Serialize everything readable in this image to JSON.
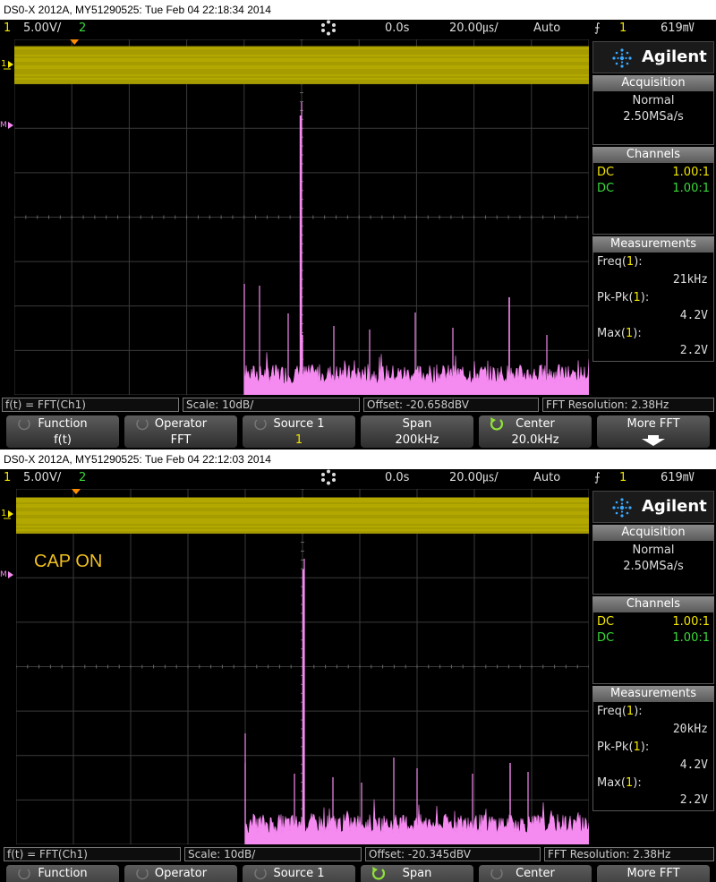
{
  "screens": [
    {
      "file_title": "DS0-X 2012A, MY51290525: Tue Feb 04 22:18:34 2014",
      "status": {
        "ch1_num": "1",
        "ch1_scale": "5.00V/",
        "ch2_num": "2",
        "delay": "0.0s",
        "timebase": "20.00㎲/",
        "trigger_mode": "Auto",
        "trigger_ch": "1",
        "trigger_level": "619㎷"
      },
      "brand": "Agilent",
      "acquisition": {
        "title": "Acquisition",
        "mode": "Normal",
        "rate": "2.50MSa/s"
      },
      "channels": {
        "title": "Channels",
        "rows": [
          {
            "coupling": "DC",
            "probe": "1.00:1",
            "color": "#f2e600"
          },
          {
            "coupling": "DC",
            "probe": "1.00:1",
            "color": "#3adb3a"
          }
        ]
      },
      "measurements": {
        "title": "Measurements",
        "items": [
          {
            "name": "Freq",
            "ch": "1",
            "value": "21kHz"
          },
          {
            "name": "Pk-Pk",
            "ch": "1",
            "value": "4.2V"
          },
          {
            "name": "Max",
            "ch": "1",
            "value": "2.2V"
          }
        ]
      },
      "info": {
        "function": "f(t) = FFT(Ch1)",
        "scale": "Scale: 10dB/",
        "offset": "Offset: -20.658dBV",
        "resolution": "FFT Resolution: 2.38Hz"
      },
      "softkeys": [
        {
          "top": "Function",
          "bottom": "f(t)"
        },
        {
          "top": "Operator",
          "bottom": "FFT"
        },
        {
          "top": "Source 1",
          "bottom": "1"
        },
        {
          "top": "Span",
          "bottom": "200kHz"
        },
        {
          "top": "Center",
          "bottom": "20.0kHz"
        },
        {
          "top": "More FFT",
          "bottom": ""
        }
      ],
      "annotation": ""
    },
    {
      "file_title": "DS0-X 2012A, MY51290525: Tue Feb 04 22:12:03 2014",
      "status": {
        "ch1_num": "1",
        "ch1_scale": "5.00V/",
        "ch2_num": "2",
        "delay": "0.0s",
        "timebase": "20.00㎲/",
        "trigger_mode": "Auto",
        "trigger_ch": "1",
        "trigger_level": "619㎷"
      },
      "brand": "Agilent",
      "acquisition": {
        "title": "Acquisition",
        "mode": "Normal",
        "rate": "2.50MSa/s"
      },
      "channels": {
        "title": "Channels",
        "rows": [
          {
            "coupling": "DC",
            "probe": "1.00:1",
            "color": "#f2e600"
          },
          {
            "coupling": "DC",
            "probe": "1.00:1",
            "color": "#3adb3a"
          }
        ]
      },
      "measurements": {
        "title": "Measurements",
        "items": [
          {
            "name": "Freq",
            "ch": "1",
            "value": "20kHz"
          },
          {
            "name": "Pk-Pk",
            "ch": "1",
            "value": "4.2V"
          },
          {
            "name": "Max",
            "ch": "1",
            "value": "2.2V"
          }
        ]
      },
      "info": {
        "function": "f(t) = FFT(Ch1)",
        "scale": "Scale: 10dB/",
        "offset": "Offset: -20.345dBV",
        "resolution": "FFT Resolution: 2.38Hz"
      },
      "softkeys": [
        {
          "top": "Function",
          "bottom": ""
        },
        {
          "top": "Operator",
          "bottom": ""
        },
        {
          "top": "Source 1",
          "bottom": ""
        },
        {
          "top": "Span",
          "bottom": ""
        },
        {
          "top": "Center",
          "bottom": ""
        },
        {
          "top": "More FFT",
          "bottom": ""
        }
      ],
      "annotation": "CAP ON"
    }
  ],
  "colors": {
    "ch1": "#f2e600",
    "ch2": "#3adb3a",
    "fft": "#f58af0",
    "grid": "#3a3a3a",
    "accent_green": "#8fe03a"
  }
}
